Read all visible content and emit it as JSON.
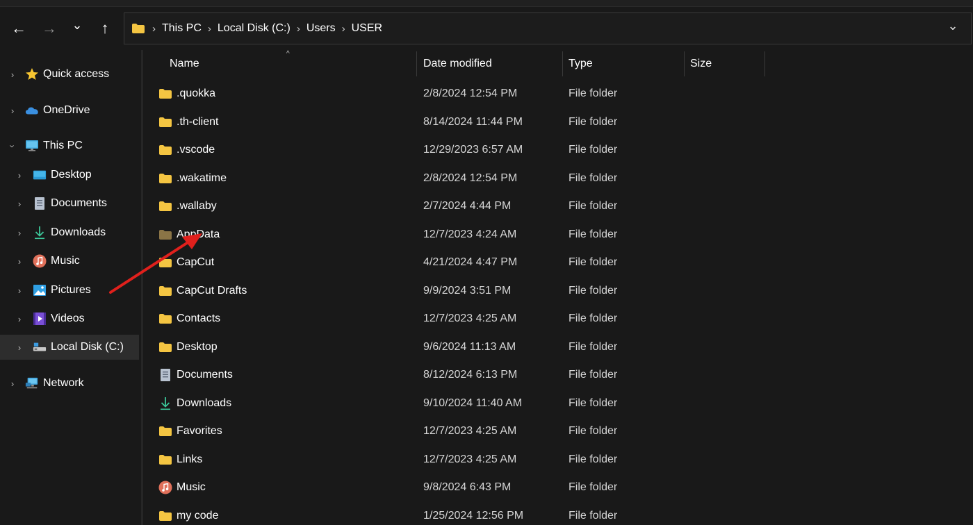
{
  "nav": {
    "back_glyph": "←",
    "forward_glyph": "→",
    "recent_glyph": "⌄",
    "up_glyph": "↑"
  },
  "address": {
    "crumbs": [
      "This PC",
      "Local Disk (C:)",
      "Users",
      "USER"
    ],
    "separator": "›",
    "dropdown_glyph": "⌄"
  },
  "sidebar": {
    "items": [
      {
        "label": "Quick access",
        "icon": "star-icon",
        "expanded": false
      },
      {
        "label": "OneDrive",
        "icon": "cloud-icon",
        "expanded": false
      },
      {
        "label": "This PC",
        "icon": "monitor-icon",
        "expanded": true
      },
      {
        "label": "Desktop",
        "icon": "desktop-icon",
        "expanded": false
      },
      {
        "label": "Documents",
        "icon": "document-icon",
        "expanded": false
      },
      {
        "label": "Downloads",
        "icon": "download-icon",
        "expanded": false
      },
      {
        "label": "Music",
        "icon": "music-icon",
        "expanded": false
      },
      {
        "label": "Pictures",
        "icon": "pictures-icon",
        "expanded": false
      },
      {
        "label": "Videos",
        "icon": "videos-icon",
        "expanded": false
      },
      {
        "label": "Local Disk (C:)",
        "icon": "drive-icon",
        "expanded": false,
        "selected": true
      },
      {
        "label": "Network",
        "icon": "network-icon",
        "expanded": false
      }
    ]
  },
  "columns": {
    "name": "Name",
    "date": "Date modified",
    "type": "Type",
    "size": "Size",
    "sort_glyph": "^"
  },
  "files": [
    {
      "name": ".quokka",
      "date": "2/8/2024 12:54 PM",
      "type": "File folder",
      "icon": "folder-icon"
    },
    {
      "name": ".th-client",
      "date": "8/14/2024 11:44 PM",
      "type": "File folder",
      "icon": "folder-icon"
    },
    {
      "name": ".vscode",
      "date": "12/29/2023 6:57 AM",
      "type": "File folder",
      "icon": "folder-icon"
    },
    {
      "name": ".wakatime",
      "date": "2/8/2024 12:54 PM",
      "type": "File folder",
      "icon": "folder-icon"
    },
    {
      "name": ".wallaby",
      "date": "2/7/2024 4:44 PM",
      "type": "File folder",
      "icon": "folder-icon"
    },
    {
      "name": "AppData",
      "date": "12/7/2023 4:24 AM",
      "type": "File folder",
      "icon": "hidden-folder-icon"
    },
    {
      "name": "CapCut",
      "date": "4/21/2024 4:47 PM",
      "type": "File folder",
      "icon": "folder-icon"
    },
    {
      "name": "CapCut Drafts",
      "date": "9/9/2024 3:51 PM",
      "type": "File folder",
      "icon": "folder-icon"
    },
    {
      "name": "Contacts",
      "date": "12/7/2023 4:25 AM",
      "type": "File folder",
      "icon": "folder-icon"
    },
    {
      "name": "Desktop",
      "date": "9/6/2024 11:13 AM",
      "type": "File folder",
      "icon": "folder-icon"
    },
    {
      "name": "Documents",
      "date": "8/12/2024 6:13 PM",
      "type": "File folder",
      "icon": "document-icon"
    },
    {
      "name": "Downloads",
      "date": "9/10/2024 11:40 AM",
      "type": "File folder",
      "icon": "download-icon"
    },
    {
      "name": "Favorites",
      "date": "12/7/2023 4:25 AM",
      "type": "File folder",
      "icon": "folder-icon"
    },
    {
      "name": "Links",
      "date": "12/7/2023 4:25 AM",
      "type": "File folder",
      "icon": "folder-icon"
    },
    {
      "name": "Music",
      "date": "9/8/2024 6:43 PM",
      "type": "File folder",
      "icon": "music-icon"
    },
    {
      "name": "my code",
      "date": "1/25/2024 12:56 PM",
      "type": "File folder",
      "icon": "folder-icon"
    }
  ],
  "colors": {
    "background": "#191919",
    "folder": "#f4c542",
    "hidden_folder": "#8a7446",
    "annotation_arrow": "#e0201c",
    "selected": "#2d2d2d"
  }
}
